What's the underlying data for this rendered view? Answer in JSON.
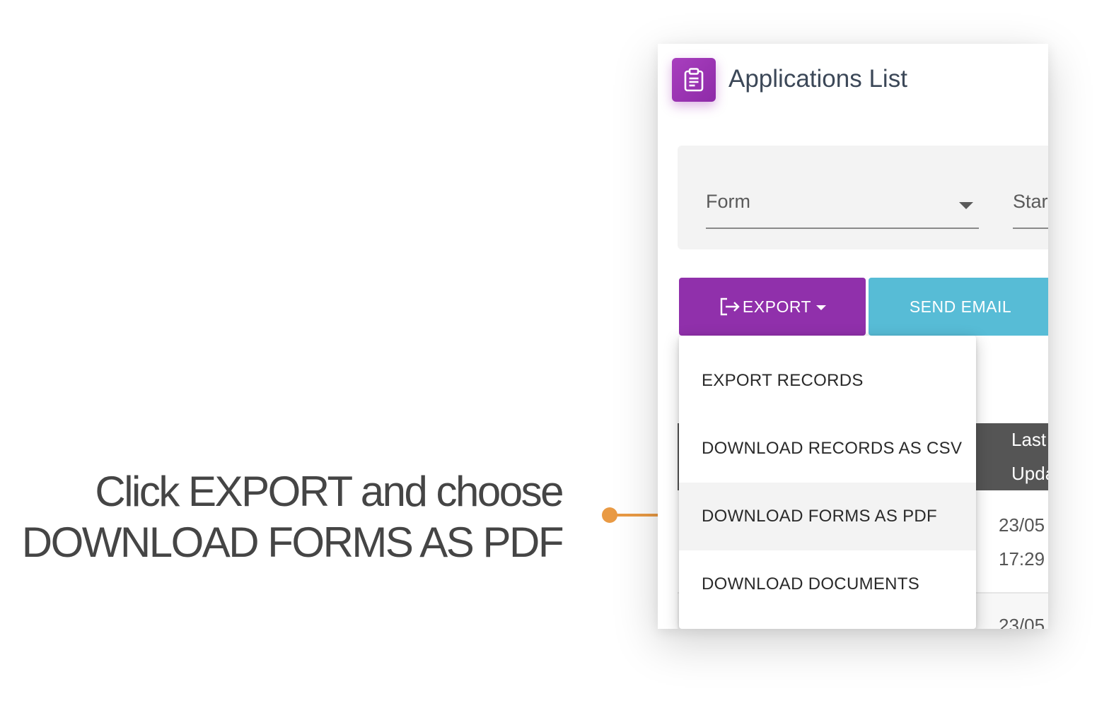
{
  "instruction": {
    "line1": "Click EXPORT and choose",
    "line2": "DOWNLOAD FORMS AS PDF"
  },
  "header": {
    "title": "Applications List",
    "icon": "clipboard-icon"
  },
  "filters": {
    "form_label": "Form",
    "start_label": "Start"
  },
  "toolbar": {
    "export_label": "EXPORT",
    "send_email_label": "SEND EMAIL"
  },
  "export_menu": {
    "items": [
      {
        "label": "EXPORT RECORDS"
      },
      {
        "label": "DOWNLOAD RECORDS AS CSV"
      },
      {
        "label": "DOWNLOAD FORMS AS PDF",
        "highlighted": true
      },
      {
        "label": "DOWNLOAD DOCUMENTS"
      }
    ]
  },
  "table": {
    "header_line1": "Last",
    "header_line2": "Updated",
    "rows": [
      {
        "date": "23/05",
        "time": "17:29"
      },
      {
        "date": "23/05"
      }
    ]
  },
  "colors": {
    "primary": "#9030ab",
    "info": "#57bcd6",
    "callout": "#e99a44",
    "table_header": "#555555"
  }
}
